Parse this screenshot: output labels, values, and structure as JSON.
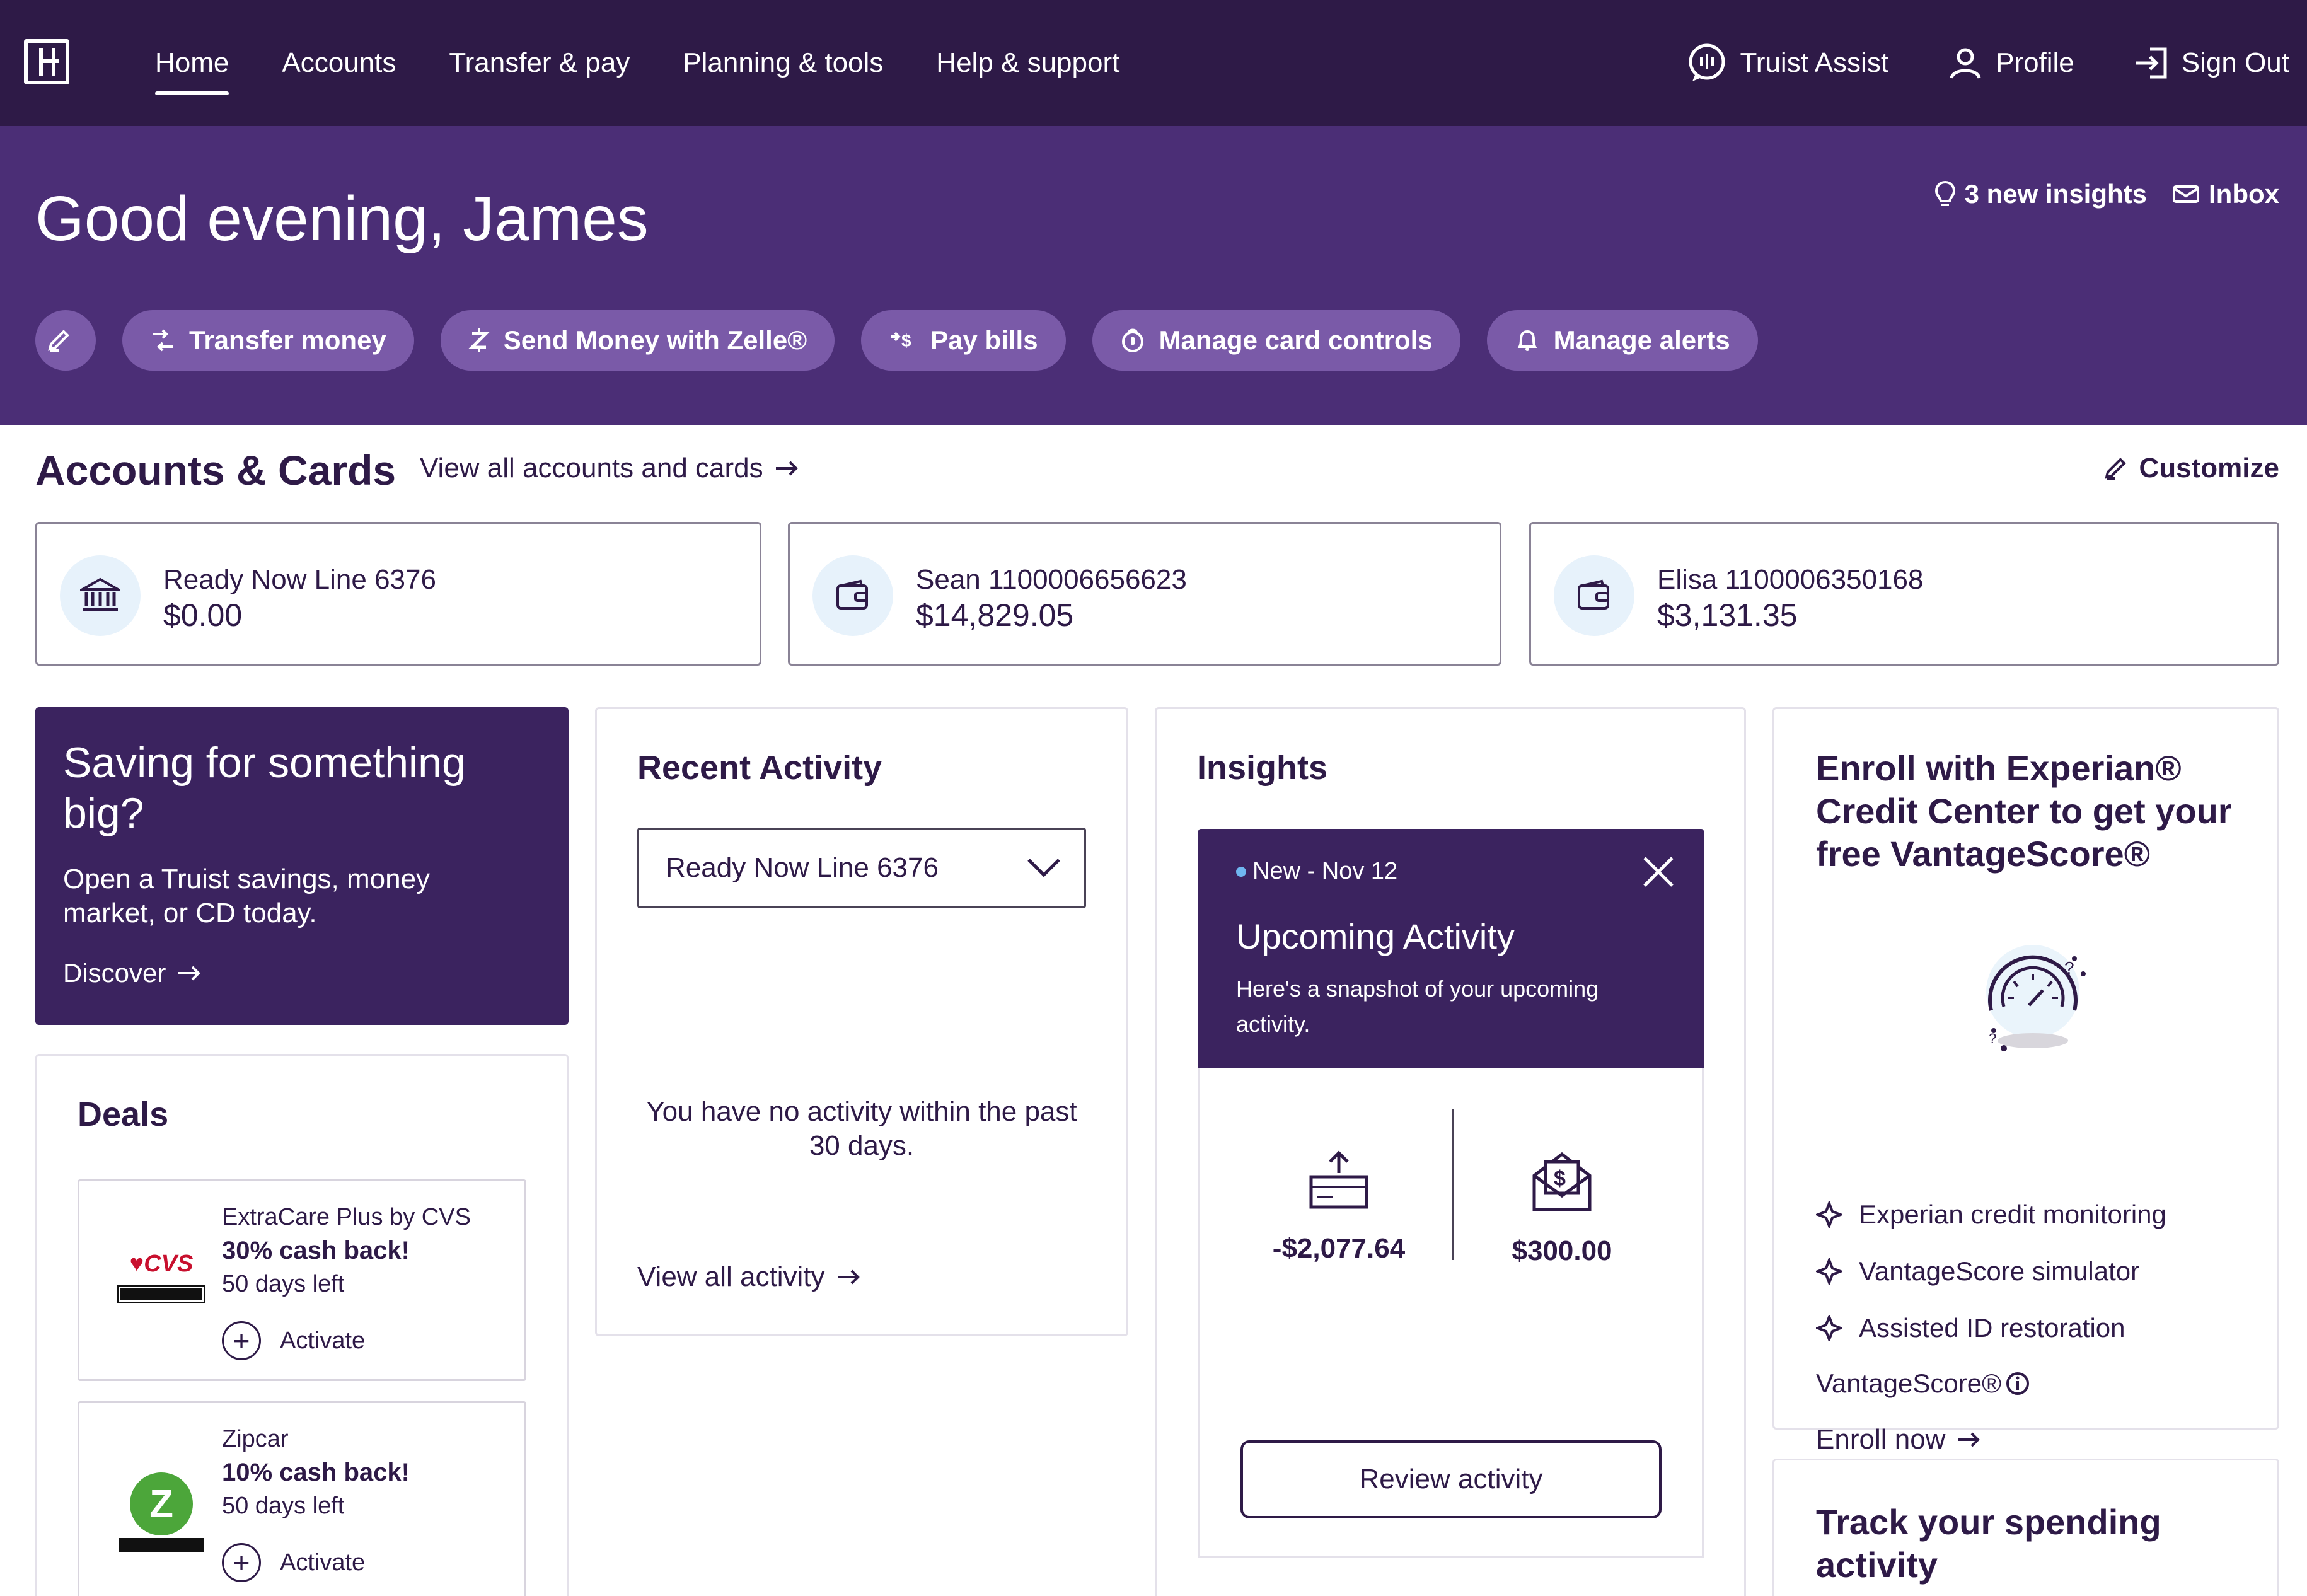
{
  "nav": {
    "links": [
      "Home",
      "Accounts",
      "Transfer & pay",
      "Planning & tools",
      "Help & support"
    ],
    "assist": "Truist Assist",
    "profile": "Profile",
    "signout": "Sign Out"
  },
  "hero": {
    "greeting": "Good evening, James",
    "insights": "3 new insights",
    "inbox": "Inbox",
    "actions": [
      "Transfer money",
      "Send Money with Zelle®",
      "Pay bills",
      "Manage card controls",
      "Manage alerts"
    ]
  },
  "accounts": {
    "title": "Accounts & Cards",
    "view_all": "View all accounts and cards",
    "customize": "Customize",
    "items": [
      {
        "name": "Ready Now Line 6376",
        "balance": "$0.00",
        "icon": "bank-icon"
      },
      {
        "name": "Sean 1100006656623",
        "balance": "$14,829.05",
        "icon": "wallet-icon"
      },
      {
        "name": "Elisa 1100006350168",
        "balance": "$3,131.35",
        "icon": "wallet-icon"
      }
    ]
  },
  "promo": {
    "title": "Saving for something big?",
    "body": "Open a Truist savings, money market, or CD today.",
    "link": "Discover"
  },
  "deals": {
    "title": "Deals",
    "items": [
      {
        "merchant": "ExtraCare Plus by CVS",
        "cashback": "30% cash back!",
        "days": "50 days left",
        "action": "Activate",
        "logo_text": "♥CVS"
      },
      {
        "merchant": "Zipcar",
        "cashback": "10% cash back!",
        "days": "50 days left",
        "action": "Activate",
        "logo_text": "Z"
      }
    ]
  },
  "recent": {
    "title": "Recent Activity",
    "selected": "Ready Now Line 6376",
    "empty": "You have no activity within the past 30 days.",
    "view_all": "View all activity"
  },
  "insights": {
    "title": "Insights",
    "tag": "New - Nov 12",
    "card_title": "Upcoming Activity",
    "card_body": "Here's a snapshot of your upcoming activity.",
    "outgoing": "-$2,077.64",
    "incoming": "$300.00",
    "button": "Review activity"
  },
  "experian": {
    "title": "Enroll with Experian® Credit Center to get your free VantageScore®",
    "features": [
      "Experian credit monitoring",
      "VantageScore simulator",
      "Assisted ID restoration"
    ],
    "vs_label": "VantageScore®",
    "link": "Enroll now"
  },
  "track": {
    "title": "Track your spending activity"
  },
  "colors": {
    "nav": "#2e1a47",
    "hero": "#4b2e76",
    "pill": "#7a5aa8",
    "promo": "#3b235f"
  }
}
